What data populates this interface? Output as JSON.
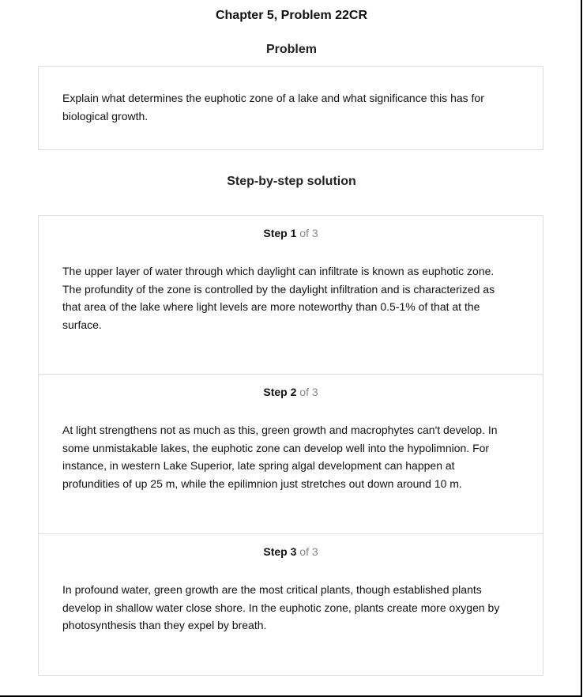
{
  "header": {
    "title": "Chapter 5, Problem 22CR"
  },
  "problem": {
    "heading": "Problem",
    "text": "Explain what determines the euphotic zone of a lake and what significance this has for biological growth."
  },
  "solution": {
    "heading": "Step-by-step solution",
    "step_word": "Step",
    "steps": [
      {
        "number": "1",
        "of_label": "of 3",
        "text": "The upper layer of water through which daylight can infiltrate is known as euphotic zone. The profundity of the zone is controlled by the daylight infiltration and is characterized as that area of the lake where light levels are more noteworthy than 0.5-1% of that at the surface."
      },
      {
        "number": "2",
        "of_label": "of 3",
        "text": "At light strengthens not as much as this, green growth and macrophytes can't develop. In some unmistakable lakes, the euphotic zone can develop well into the hypolimnion. For instance, in western Lake Superior, late spring algal development can happen at profundities of up 25 m, while the epilimnion just stretches out down around 10 m."
      },
      {
        "number": "3",
        "of_label": "of 3",
        "text": "In profound water, green growth are the most critical plants, though established plants develop in shallow water close shore. In the euphotic zone, plants create more oxygen by photosynthesis than they expel by breath."
      }
    ]
  }
}
